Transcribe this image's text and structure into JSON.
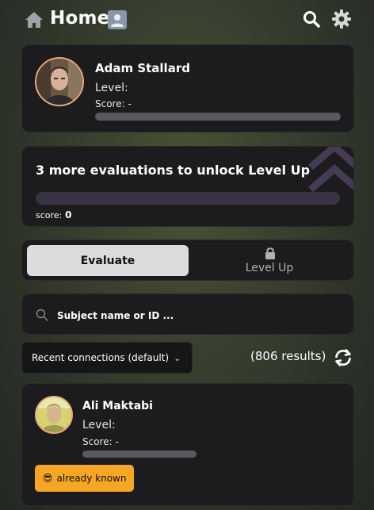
{
  "header": {
    "title": "Home",
    "icons": {
      "home": "home-icon",
      "profile": "profile-icon",
      "search": "search-icon",
      "settings": "gear-icon"
    }
  },
  "profile": {
    "name": "Adam Stallard",
    "level_label": "Level:",
    "score_label": "Score: -"
  },
  "evaluations": {
    "message": "3 more evaluations to unlock Level Up",
    "score_label": "score:",
    "score_value": "0",
    "progress": 0
  },
  "tabs": [
    {
      "label": "Evaluate",
      "active": true
    },
    {
      "label": "Level Up",
      "active": false,
      "locked": true
    }
  ],
  "search": {
    "placeholder": "Subject name or ID ..."
  },
  "filter": {
    "selected": "Recent connections (default)"
  },
  "results": {
    "count_label": "(806 results)"
  },
  "connections": [
    {
      "name": "Ali Maktabi",
      "level_label": "Level:",
      "score_label": "Score: -",
      "badge_emoji": "😎",
      "badge_text": "already known"
    }
  ],
  "colors": {
    "accent": "#f5a623",
    "avatar_ring": "#e8a87c",
    "card_bg": "#1c1c1e",
    "eval_bar": "#3a3346"
  }
}
